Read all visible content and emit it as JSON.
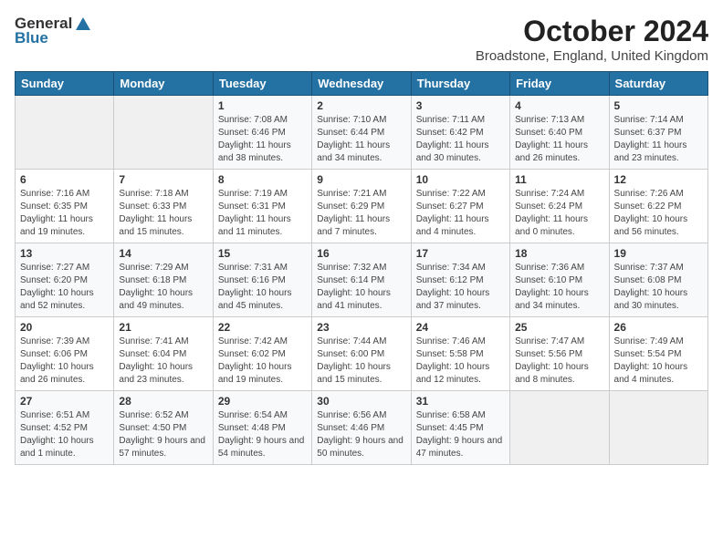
{
  "header": {
    "logo_general": "General",
    "logo_blue": "Blue",
    "month_title": "October 2024",
    "location": "Broadstone, England, United Kingdom"
  },
  "days_of_week": [
    "Sunday",
    "Monday",
    "Tuesday",
    "Wednesday",
    "Thursday",
    "Friday",
    "Saturday"
  ],
  "weeks": [
    [
      {
        "day": "",
        "content": ""
      },
      {
        "day": "",
        "content": ""
      },
      {
        "day": "1",
        "content": "Sunrise: 7:08 AM\nSunset: 6:46 PM\nDaylight: 11 hours and 38 minutes."
      },
      {
        "day": "2",
        "content": "Sunrise: 7:10 AM\nSunset: 6:44 PM\nDaylight: 11 hours and 34 minutes."
      },
      {
        "day": "3",
        "content": "Sunrise: 7:11 AM\nSunset: 6:42 PM\nDaylight: 11 hours and 30 minutes."
      },
      {
        "day": "4",
        "content": "Sunrise: 7:13 AM\nSunset: 6:40 PM\nDaylight: 11 hours and 26 minutes."
      },
      {
        "day": "5",
        "content": "Sunrise: 7:14 AM\nSunset: 6:37 PM\nDaylight: 11 hours and 23 minutes."
      }
    ],
    [
      {
        "day": "6",
        "content": "Sunrise: 7:16 AM\nSunset: 6:35 PM\nDaylight: 11 hours and 19 minutes."
      },
      {
        "day": "7",
        "content": "Sunrise: 7:18 AM\nSunset: 6:33 PM\nDaylight: 11 hours and 15 minutes."
      },
      {
        "day": "8",
        "content": "Sunrise: 7:19 AM\nSunset: 6:31 PM\nDaylight: 11 hours and 11 minutes."
      },
      {
        "day": "9",
        "content": "Sunrise: 7:21 AM\nSunset: 6:29 PM\nDaylight: 11 hours and 7 minutes."
      },
      {
        "day": "10",
        "content": "Sunrise: 7:22 AM\nSunset: 6:27 PM\nDaylight: 11 hours and 4 minutes."
      },
      {
        "day": "11",
        "content": "Sunrise: 7:24 AM\nSunset: 6:24 PM\nDaylight: 11 hours and 0 minutes."
      },
      {
        "day": "12",
        "content": "Sunrise: 7:26 AM\nSunset: 6:22 PM\nDaylight: 10 hours and 56 minutes."
      }
    ],
    [
      {
        "day": "13",
        "content": "Sunrise: 7:27 AM\nSunset: 6:20 PM\nDaylight: 10 hours and 52 minutes."
      },
      {
        "day": "14",
        "content": "Sunrise: 7:29 AM\nSunset: 6:18 PM\nDaylight: 10 hours and 49 minutes."
      },
      {
        "day": "15",
        "content": "Sunrise: 7:31 AM\nSunset: 6:16 PM\nDaylight: 10 hours and 45 minutes."
      },
      {
        "day": "16",
        "content": "Sunrise: 7:32 AM\nSunset: 6:14 PM\nDaylight: 10 hours and 41 minutes."
      },
      {
        "day": "17",
        "content": "Sunrise: 7:34 AM\nSunset: 6:12 PM\nDaylight: 10 hours and 37 minutes."
      },
      {
        "day": "18",
        "content": "Sunrise: 7:36 AM\nSunset: 6:10 PM\nDaylight: 10 hours and 34 minutes."
      },
      {
        "day": "19",
        "content": "Sunrise: 7:37 AM\nSunset: 6:08 PM\nDaylight: 10 hours and 30 minutes."
      }
    ],
    [
      {
        "day": "20",
        "content": "Sunrise: 7:39 AM\nSunset: 6:06 PM\nDaylight: 10 hours and 26 minutes."
      },
      {
        "day": "21",
        "content": "Sunrise: 7:41 AM\nSunset: 6:04 PM\nDaylight: 10 hours and 23 minutes."
      },
      {
        "day": "22",
        "content": "Sunrise: 7:42 AM\nSunset: 6:02 PM\nDaylight: 10 hours and 19 minutes."
      },
      {
        "day": "23",
        "content": "Sunrise: 7:44 AM\nSunset: 6:00 PM\nDaylight: 10 hours and 15 minutes."
      },
      {
        "day": "24",
        "content": "Sunrise: 7:46 AM\nSunset: 5:58 PM\nDaylight: 10 hours and 12 minutes."
      },
      {
        "day": "25",
        "content": "Sunrise: 7:47 AM\nSunset: 5:56 PM\nDaylight: 10 hours and 8 minutes."
      },
      {
        "day": "26",
        "content": "Sunrise: 7:49 AM\nSunset: 5:54 PM\nDaylight: 10 hours and 4 minutes."
      }
    ],
    [
      {
        "day": "27",
        "content": "Sunrise: 6:51 AM\nSunset: 4:52 PM\nDaylight: 10 hours and 1 minute."
      },
      {
        "day": "28",
        "content": "Sunrise: 6:52 AM\nSunset: 4:50 PM\nDaylight: 9 hours and 57 minutes."
      },
      {
        "day": "29",
        "content": "Sunrise: 6:54 AM\nSunset: 4:48 PM\nDaylight: 9 hours and 54 minutes."
      },
      {
        "day": "30",
        "content": "Sunrise: 6:56 AM\nSunset: 4:46 PM\nDaylight: 9 hours and 50 minutes."
      },
      {
        "day": "31",
        "content": "Sunrise: 6:58 AM\nSunset: 4:45 PM\nDaylight: 9 hours and 47 minutes."
      },
      {
        "day": "",
        "content": ""
      },
      {
        "day": "",
        "content": ""
      }
    ]
  ]
}
